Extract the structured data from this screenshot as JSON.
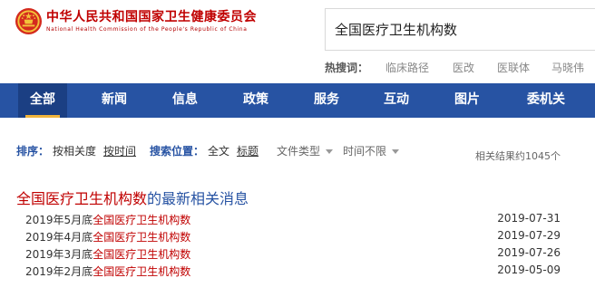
{
  "header": {
    "org_cn": "中华人民共和国国家卫生健康委员会",
    "org_en": "National Health Commission of the People's Republic of China",
    "search_value": "全国医疗卫生机构数",
    "hot_label": "热搜词：",
    "hot_words": [
      "临床路径",
      "医改",
      "医联体",
      "马晓伟"
    ]
  },
  "nav": {
    "items": [
      "全部",
      "新闻",
      "信息",
      "政策",
      "服务",
      "互动",
      "图片",
      "委机关"
    ],
    "active_index": 0
  },
  "filter": {
    "sort_label": "排序：",
    "sort_relevance": "按相关度",
    "sort_time": "按时间",
    "scope_label": "搜索位置：",
    "scope_all": "全文",
    "scope_title": "标题",
    "file_type": "文件类型",
    "time": "时间不限",
    "result_count": "相关结果约1045个"
  },
  "latest": {
    "title_keyword": "全国医疗卫生机构数",
    "title_suffix": "的最新相关消息",
    "items": [
      {
        "prefix": "2019年5月底",
        "highlight": "全国医疗卫生机构数",
        "date": "2019-07-31"
      },
      {
        "prefix": "2019年4月底",
        "highlight": "全国医疗卫生机构数",
        "date": "2019-07-29"
      },
      {
        "prefix": "2019年3月底",
        "highlight": "全国医疗卫生机构数",
        "date": "2019-07-26"
      },
      {
        "prefix": "2019年2月底",
        "highlight": "全国医疗卫生机构数",
        "date": "2019-05-09"
      }
    ]
  },
  "colors": {
    "nav_bg": "#2753a3",
    "nav_active": "#1b3f83",
    "accent_red": "#c00000",
    "active_underline": "#f0b43c"
  },
  "icons": {
    "emblem": "national-emblem-icon",
    "dropdown": "caret-down-icon"
  }
}
